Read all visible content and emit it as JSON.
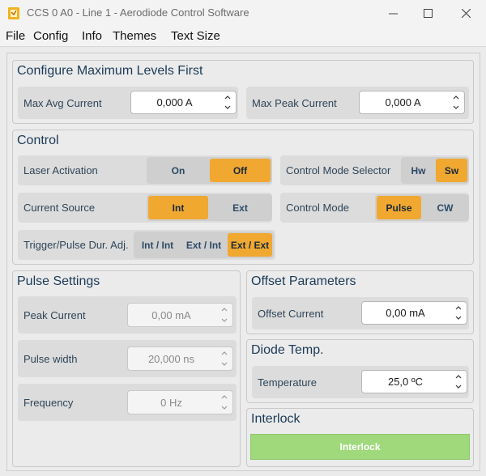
{
  "window": {
    "title": "CCS 0 A0 - Line 1 - Aerodiode Control Software"
  },
  "menu": {
    "items": [
      "File",
      "Config",
      "Info",
      "Themes",
      "Text Size"
    ]
  },
  "max_levels": {
    "title": "Configure Maximum Levels First",
    "avg": {
      "label": "Max Avg Current",
      "value": "0,000 A"
    },
    "peak": {
      "label": "Max Peak Current",
      "value": "0,000 A"
    }
  },
  "control": {
    "title": "Control",
    "laser_activation": {
      "label": "Laser Activation",
      "options": [
        "On",
        "Off"
      ],
      "selected": "Off"
    },
    "mode_selector": {
      "label": "Control Mode Selector",
      "options": [
        "Hw",
        "Sw"
      ],
      "selected": "Sw"
    },
    "current_source": {
      "label": "Current Source",
      "options": [
        "Int",
        "Ext"
      ],
      "selected": "Int"
    },
    "control_mode": {
      "label": "Control Mode",
      "options": [
        "Pulse",
        "CW"
      ],
      "selected": "Pulse"
    },
    "trigger": {
      "label": "Trigger/Pulse Dur. Adj.",
      "options": [
        "Int / Int",
        "Ext / Int",
        "Ext / Ext"
      ],
      "selected": "Ext / Ext"
    }
  },
  "pulse": {
    "title": "Pulse Settings",
    "peak_current": {
      "label": "Peak Current",
      "value": "0,00 mA"
    },
    "pulse_width": {
      "label": "Pulse width",
      "value": "20,000 ns"
    },
    "frequency": {
      "label": "Frequency",
      "value": "0 Hz"
    }
  },
  "offset": {
    "title": "Offset Parameters",
    "current": {
      "label": "Offset Current",
      "value": "0,00 mA"
    }
  },
  "diode": {
    "title": "Diode Temp.",
    "temperature": {
      "label": "Temperature",
      "value": "25,0 ºC"
    }
  },
  "interlock": {
    "title": "Interlock",
    "button": "Interlock"
  },
  "colors": {
    "accent": "#f0a830",
    "interlock_ok": "#9fd97c",
    "heading": "#1b3a57"
  }
}
